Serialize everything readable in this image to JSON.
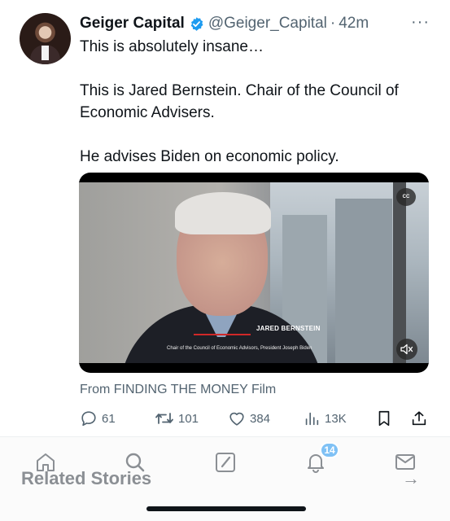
{
  "tweet": {
    "author_name": "Geiger Capital",
    "handle": "@Geiger_Capital",
    "separator": "·",
    "time": "42m",
    "more": "···",
    "lines": [
      "This is absolutely insane…",
      "This is Jared Bernstein. Chair of the Council of Economic Advisers.",
      "He advises Biden on economic policy."
    ]
  },
  "video": {
    "caption_name": "JARED BERNSTEIN",
    "caption_title": "Chair of the Council of Economic Advisors, President Joseph Biden",
    "cc_label": "CC",
    "source": "From FINDING THE MONEY Film"
  },
  "actions": {
    "replies": "61",
    "retweets": "101",
    "likes": "384",
    "views": "13K"
  },
  "bottom_nav": {
    "notifications_badge": "14",
    "related_label": "Related Stories",
    "related_arrow": "→"
  },
  "colors": {
    "verified": "#1d9bf0",
    "secondary_text": "#536471",
    "badge": "#7fc1f5"
  }
}
